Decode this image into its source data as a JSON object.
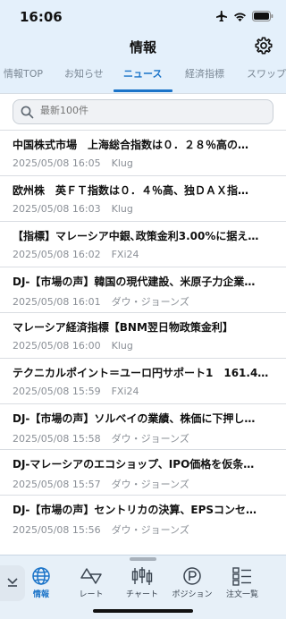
{
  "status": {
    "time": "16:06"
  },
  "header": {
    "title": "情報"
  },
  "tabs": [
    {
      "label": "情報TOP",
      "active": false
    },
    {
      "label": "お知らせ",
      "active": false
    },
    {
      "label": "ニュース",
      "active": true
    },
    {
      "label": "経済指標",
      "active": false
    },
    {
      "label": "スワップー",
      "active": false
    }
  ],
  "search": {
    "placeholder": "最新100件"
  },
  "news": [
    {
      "title": "中国株式市場　上海総合指数は０．２８％高の…",
      "datetime": "2025/05/08 16:05",
      "source": "Klug"
    },
    {
      "title": "欧州株　英ＦＴ指数は０．４％高、独ＤＡＸ指…",
      "datetime": "2025/05/08 16:03",
      "source": "Klug"
    },
    {
      "title": "【指標】マレーシア中銀､政策金利3.00%に据え…",
      "datetime": "2025/05/08 16:02",
      "source": "FXi24"
    },
    {
      "title": "DJ-【市場の声】韓国の現代建設、米原子力企業…",
      "datetime": "2025/05/08 16:01",
      "source": "ダウ・ジョーンズ"
    },
    {
      "title": "マレーシア経済指標【BNM翌日物政策金利】",
      "datetime": "2025/05/08 16:00",
      "source": "Klug"
    },
    {
      "title": "テクニカルポイント＝ユーロ円サポート1　161.4…",
      "datetime": "2025/05/08 15:59",
      "source": "FXi24"
    },
    {
      "title": "DJ-【市場の声】ソルベイの業績、株価に下押し…",
      "datetime": "2025/05/08 15:58",
      "source": "ダウ・ジョーンズ"
    },
    {
      "title": "DJ-マレーシアのエコショップ、IPO価格を仮条…",
      "datetime": "2025/05/08 15:57",
      "source": "ダウ・ジョーンズ"
    },
    {
      "title": "DJ-【市場の声】セントリカの決算、EPSコンセ…",
      "datetime": "2025/05/08 15:56",
      "source": "ダウ・ジョーンズ"
    }
  ],
  "bottom_nav": [
    {
      "label": "情報",
      "icon": "globe-icon",
      "active": true
    },
    {
      "label": "レート",
      "icon": "rate-arrows-icon",
      "active": false
    },
    {
      "label": "チャート",
      "icon": "candlestick-chart-icon",
      "active": false
    },
    {
      "label": "ポジション",
      "icon": "position-p-icon",
      "active": false
    },
    {
      "label": "注文一覧",
      "icon": "order-list-icon",
      "active": false
    }
  ],
  "colors": {
    "accent": "#1a73c8",
    "header_bg": "#e4f0fb",
    "bottom_bg": "#e7f0f8"
  }
}
